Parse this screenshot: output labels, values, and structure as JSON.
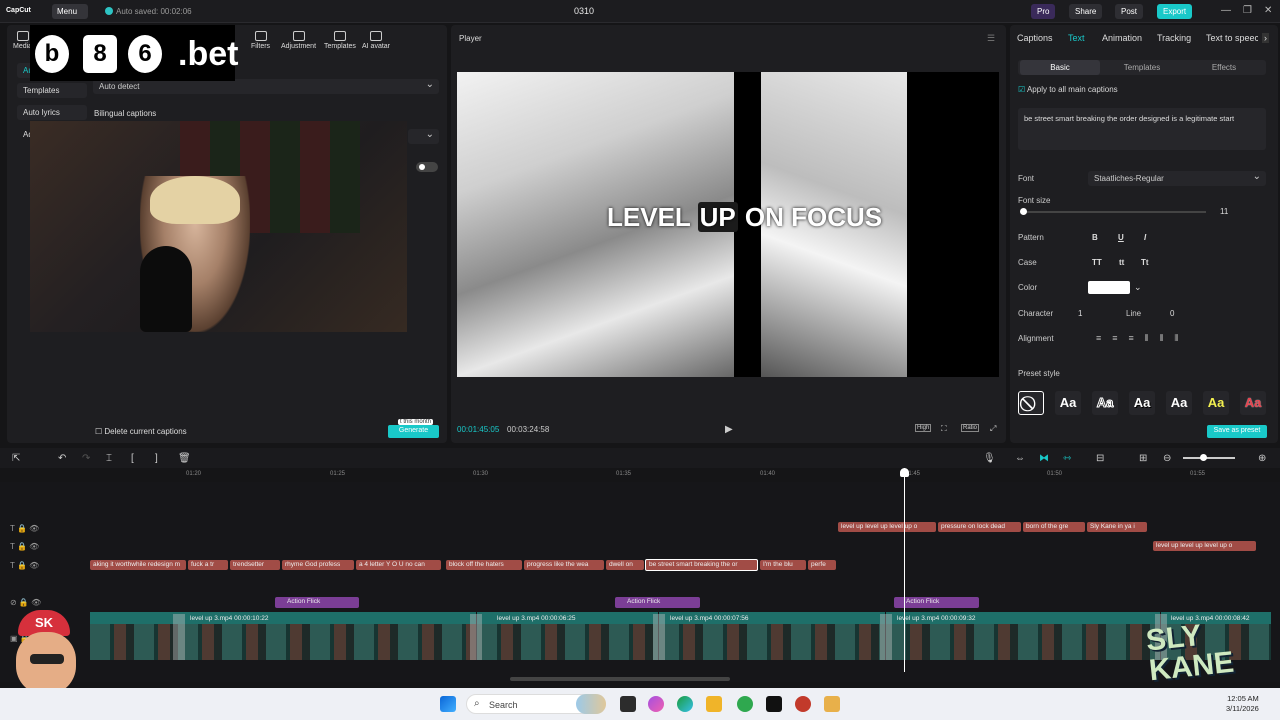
{
  "titlebar": {
    "logo": "CapCut",
    "menu": "Menu",
    "autosave": "Auto saved: 00:02:06",
    "project": "0310",
    "pro": "Pro",
    "share": "Share",
    "post": "Post",
    "export": "Export"
  },
  "left": {
    "tools": [
      "Media",
      "Filters",
      "Adjustment",
      "Templates",
      "AI avatar"
    ],
    "side": [
      "Auto",
      "Templates",
      "Auto lyrics",
      "Add"
    ],
    "language": "Auto detect",
    "bilingual": "Bilingual captions",
    "delete_captions": "Delete current captions",
    "generate": "Generate",
    "generate_tag": "t this month"
  },
  "overlay": {
    "c1": "b",
    "c2": "8",
    "c3": "6",
    "bet": ".bet"
  },
  "player": {
    "title": "Player",
    "caption_a": "LEVEL",
    "caption_hl": "UP",
    "caption_b": "ON FOCUS",
    "current": "00:01:45:05",
    "total": "00:03:24:58",
    "high": "High",
    "ratio": "Ratio"
  },
  "right": {
    "tabs": [
      "Captions",
      "Text",
      "Animation",
      "Tracking",
      "Text to speech"
    ],
    "subtabs": [
      "Basic",
      "Templates",
      "Effects"
    ],
    "apply_all": "Apply to all main captions",
    "text": "be street smart breaking the order designed is a legitimate start",
    "font_label": "Font",
    "font_value": "Staatliches-Regular",
    "fontsize_label": "Font size",
    "fontsize_value": "11",
    "pattern_label": "Pattern",
    "case_label": "Case",
    "color_label": "Color",
    "character_label": "Character",
    "character_value": "1",
    "line_label": "Line",
    "line_value": "0",
    "alignment_label": "Alignment",
    "preset_label": "Preset style",
    "save_preset": "Save as preset",
    "pattern": [
      "B",
      "U",
      "I"
    ],
    "case": [
      "TT",
      "tt",
      "Tt"
    ],
    "presets": [
      "Aa",
      "Aa",
      "Aa",
      "Aa",
      "Aa",
      "Aa"
    ]
  },
  "ruler": [
    "01:20",
    "01:25",
    "01:30",
    "01:35",
    "01:40",
    "01:45",
    "01:50",
    "01:55"
  ],
  "captions_row1": [
    "level up level up level up o",
    "pressure on lock dead",
    "born of the gre",
    "Sly Kane in ya i"
  ],
  "captions_row2": [
    "level up level up level up o"
  ],
  "captions_row3": [
    "aking it worthwhile redesign m",
    "fuck a tr",
    "trendsetter",
    "rhyme God profess",
    "a 4 letter Y O U no can",
    "block off the haters",
    "progress like the wea",
    "dwell on",
    "be street smart breaking the or",
    "I'm the blu",
    "perfe"
  ],
  "effects": [
    "Action Flick",
    "Action Flick",
    "Action Flick"
  ],
  "video_clips": [
    {
      "name": "level up 3.mp4",
      "dur": "00:00:10:22"
    },
    {
      "name": "level up 3.mp4",
      "dur": "00:00:06:25"
    },
    {
      "name": "level up 3.mp4",
      "dur": "00:00:07:56"
    },
    {
      "name": "level up 3.mp4",
      "dur": "00:00:09:32"
    },
    {
      "name": "level up 3.mp4",
      "dur": "00:00:08:42"
    }
  ],
  "taskbar": {
    "search": "Search",
    "time": "12:05 AM",
    "date": "3/11/2026"
  },
  "brand": {
    "sk": "SK",
    "slykane": "SLY KANE"
  }
}
